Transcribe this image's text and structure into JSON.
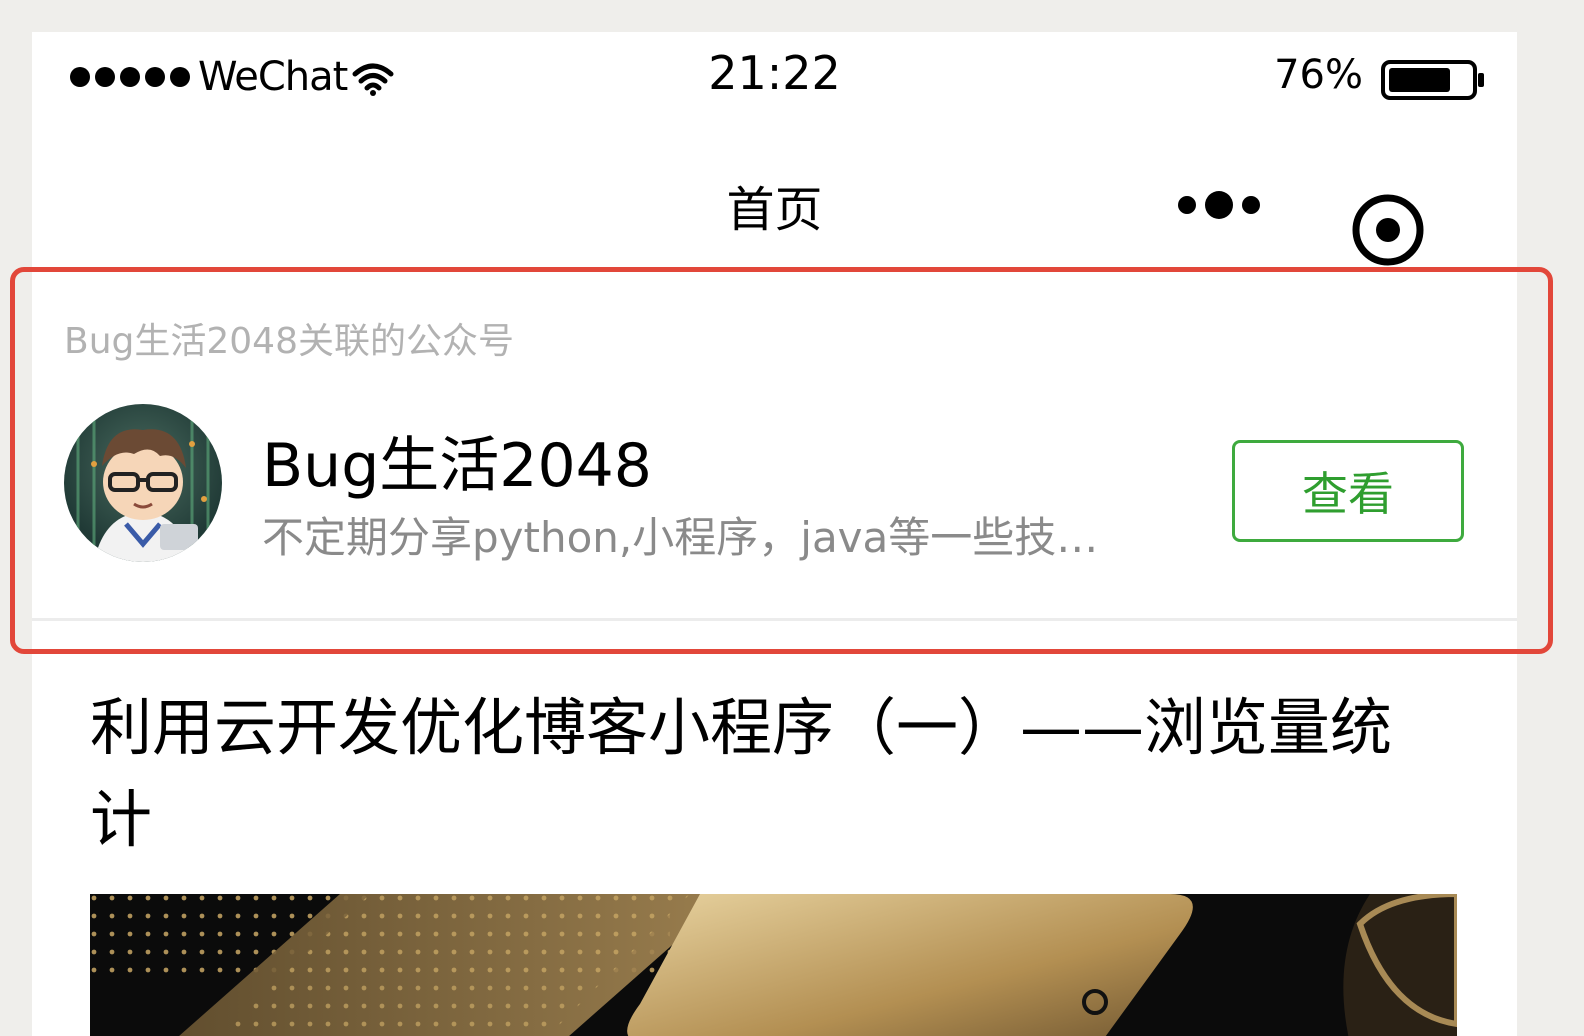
{
  "status_bar": {
    "carrier": "WeChat",
    "time": "21:22",
    "battery_pct": "76%",
    "battery_level": 0.76,
    "signal_dots": 5
  },
  "nav": {
    "title": "首页",
    "more_icon": "more-dots-icon",
    "close_icon": "target-circle-icon"
  },
  "account_card": {
    "caption": "Bug生活2048关联的公众号",
    "name": "Bug生活2048",
    "description": "不定期分享python,小程序，java等一些技…",
    "view_button": "查看",
    "accent_color": "#3eaa3e",
    "highlight_color": "#e2473a"
  },
  "article": {
    "title": "利用云开发优化博客小程序（一）——浏览量统计"
  }
}
